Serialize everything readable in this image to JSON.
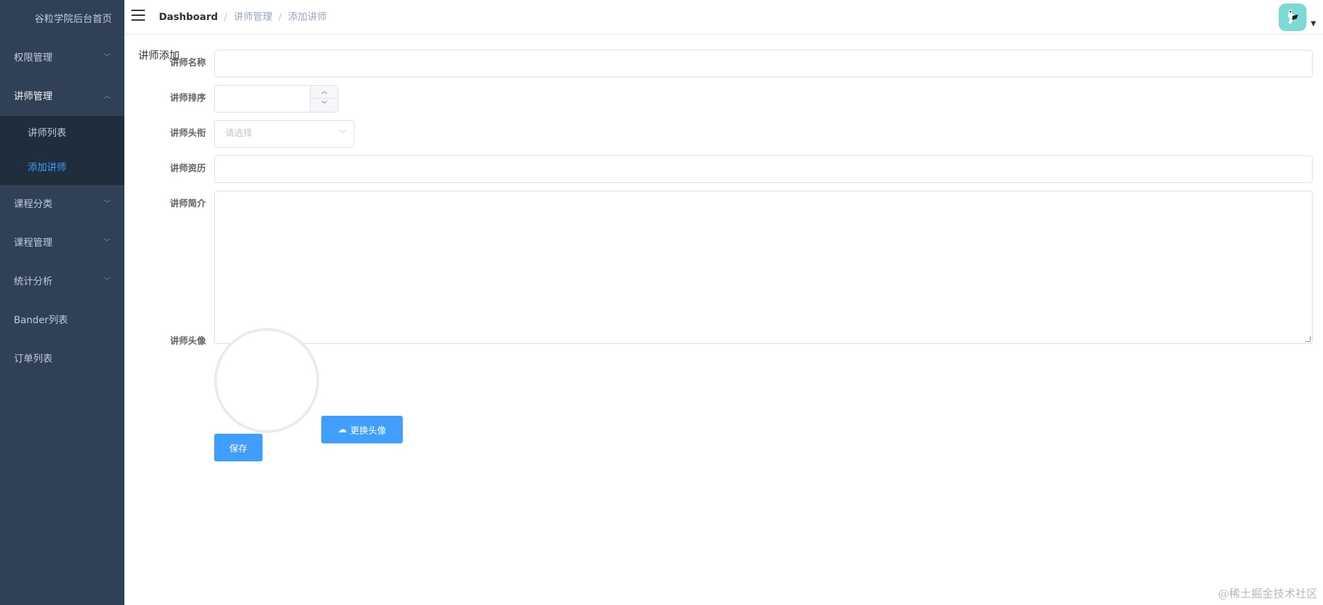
{
  "sidebar": {
    "logo_text": "谷粒学院后台首页",
    "items": [
      {
        "label": "权限管理"
      },
      {
        "label": "讲师管理"
      },
      {
        "label": "课程分类"
      },
      {
        "label": "课程管理"
      },
      {
        "label": "统计分析"
      },
      {
        "label": "Bander列表"
      },
      {
        "label": "订单列表"
      }
    ],
    "teacher_sub": [
      {
        "label": "讲师列表"
      },
      {
        "label": "添加讲师"
      }
    ]
  },
  "breadcrumb": {
    "root": "Dashboard",
    "sep": "/",
    "level1": "讲师管理",
    "level2": "添加讲师"
  },
  "page": {
    "title": "讲师添加"
  },
  "form": {
    "name_label": "讲师名称",
    "sort_label": "讲师排序",
    "level_label": "讲师头衔",
    "level_placeholder": "请选择",
    "career_label": "讲师资历",
    "intro_label": "讲师简介",
    "avatar_label": "讲师头像",
    "change_avatar_label": "更换头像",
    "save_label": "保存"
  },
  "colors": {
    "sidebar_bg": "#304156",
    "submenu_bg": "#1f2d3d",
    "accent": "#409eff",
    "avatar_bg": "#7dd9d5"
  },
  "watermark": "@稀土掘金技术社区"
}
